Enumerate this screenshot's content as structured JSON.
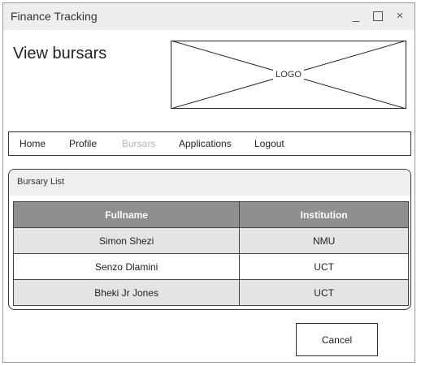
{
  "window": {
    "title": "Finance Tracking",
    "controls": {
      "minimize_icon": "minimize-icon",
      "maximize_icon": "maximize-icon",
      "close_icon": "close-icon",
      "minimize_glyph": "_",
      "close_glyph": "×"
    }
  },
  "header": {
    "page_title": "View bursars",
    "logo_text": "LOGO"
  },
  "nav": {
    "items": [
      {
        "label": "Home"
      },
      {
        "label": "Profile"
      },
      {
        "label": "Bursars",
        "active": true
      },
      {
        "label": "Applications"
      },
      {
        "label": "Logout"
      }
    ]
  },
  "bursary_panel": {
    "title": "Bursary List",
    "columns": [
      "Fullname",
      "Institution"
    ],
    "rows": [
      {
        "fullname": "Simon Shezi",
        "institution": "NMU"
      },
      {
        "fullname": "Senzo Dlamini",
        "institution": "UCT"
      },
      {
        "fullname": "Bheki Jr Jones",
        "institution": "UCT"
      }
    ]
  },
  "actions": {
    "cancel_label": "Cancel"
  },
  "colors": {
    "titlebar_bg": "#eeeeee",
    "header_row_bg": "#8f8f8f",
    "alt_row_bg": "#e4e4e4",
    "disabled_nav": "#b5b5b5"
  }
}
